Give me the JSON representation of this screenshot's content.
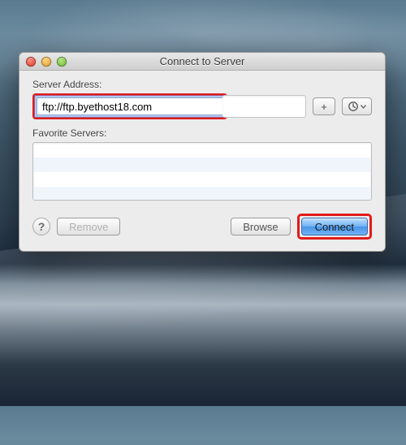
{
  "window": {
    "title": "Connect to Server"
  },
  "labels": {
    "server_address": "Server Address:",
    "favorite_servers": "Favorite Servers:"
  },
  "inputs": {
    "server_address_value": "ftp://ftp.byethost18.com"
  },
  "buttons": {
    "add": "+",
    "help": "?",
    "remove": "Remove",
    "browse": "Browse",
    "connect": "Connect"
  },
  "icons": {
    "history_menu": "clock-menu-icon",
    "close": "close-icon",
    "minimize": "minimize-icon",
    "zoom": "zoom-icon"
  },
  "highlights": {
    "address_box": true,
    "connect_box": true
  }
}
